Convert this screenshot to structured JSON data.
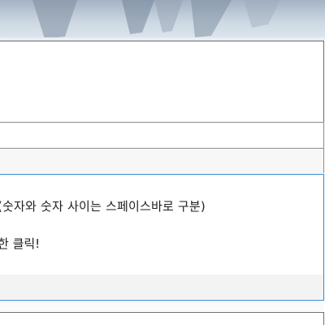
{
  "instructions": {
    "separator_note": "(숫자와 숫자 사이는 스페이스바로 구분)",
    "click_note": "한 클릭!"
  },
  "icons": {
    "hero": "decorative-photo"
  }
}
